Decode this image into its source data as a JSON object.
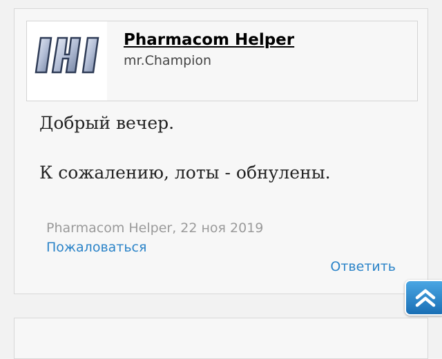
{
  "post": {
    "author": {
      "name": "Pharmacom Helper",
      "title": "mr.Champion",
      "avatar_icon": "pharmacom-logo"
    },
    "message": {
      "lines": [
        "Добрый вечер.",
        "К сожалению, лоты - обнулены."
      ]
    },
    "meta": {
      "author": "Pharmacom Helper",
      "date": "22 ноя 2019",
      "byline": "Pharmacom Helper, 22 ноя 2019"
    },
    "actions": {
      "report": "Пожаловаться",
      "reply": "Ответить"
    }
  },
  "scroll_top": {
    "icon": "double-chevron-up-icon"
  },
  "colors": {
    "link": "#2a83c8",
    "scroll_button": "#2a83c8",
    "meta_text": "#9a9a9a"
  }
}
